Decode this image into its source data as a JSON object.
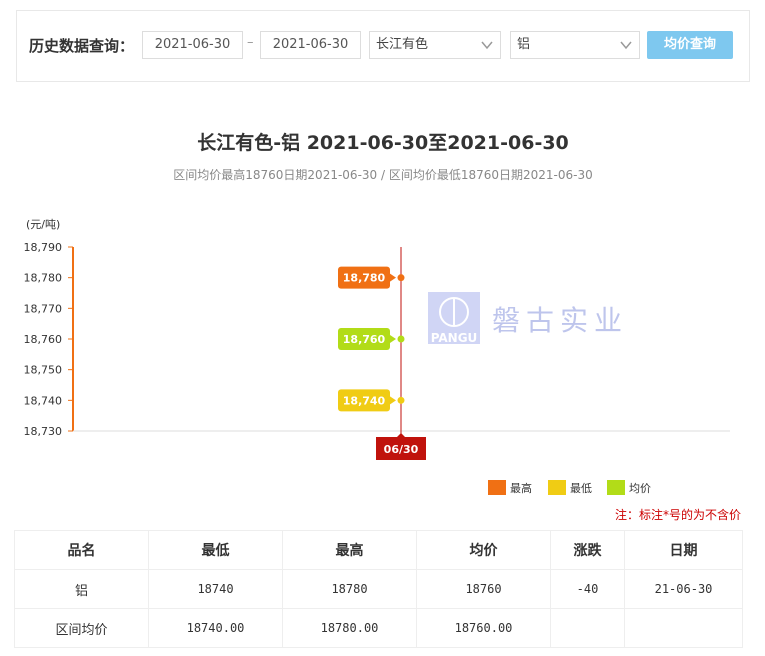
{
  "query": {
    "label": "历史数据查询：",
    "start_date": "2021-06-30",
    "separator": "–",
    "end_date": "2021-06-30",
    "market": "长江有色",
    "metal": "铝",
    "button": "均价查询"
  },
  "chart_title": "长江有色-铝 2021-06-30至2021-06-30",
  "chart_subtitle": "区间均价最高18760日期2021-06-30 / 区间均价最低18760日期2021-06-30",
  "watermark": {
    "logo_text": "PANGU",
    "company": "磐古实业"
  },
  "chart_data": {
    "type": "line",
    "unit_label": "(元/吨)",
    "ylim": [
      18730,
      18790
    ],
    "yticks": [
      "18,730",
      "18,740",
      "18,750",
      "18,760",
      "18,770",
      "18,780",
      "18,790"
    ],
    "x": [
      "06/30"
    ],
    "series": [
      {
        "name": "最高",
        "color": "#f07014",
        "values": [
          18780
        ],
        "labels": [
          "18,780"
        ]
      },
      {
        "name": "均价",
        "color": "#b2dc18",
        "values": [
          18760
        ],
        "labels": [
          "18,760"
        ]
      },
      {
        "name": "最低",
        "color": "#f0cc14",
        "values": [
          18740
        ],
        "labels": [
          "18,740"
        ]
      }
    ],
    "legend": [
      {
        "name": "最高",
        "color": "#f07014"
      },
      {
        "name": "最低",
        "color": "#f0cc14"
      },
      {
        "name": "均价",
        "color": "#b2dc18"
      }
    ],
    "legend_position": "bottom-right",
    "crosshair_color": "#c0120c"
  },
  "note": "注：标注*号的为不含价",
  "table": {
    "headers": [
      "品名",
      "最低",
      "最高",
      "均价",
      "涨跌",
      "日期"
    ],
    "rows": [
      [
        "铝",
        "18740",
        "18780",
        "18760",
        "-40",
        "21-06-30"
      ],
      [
        "区间均价",
        "18740.00",
        "18780.00",
        "18760.00",
        "",
        ""
      ]
    ]
  }
}
